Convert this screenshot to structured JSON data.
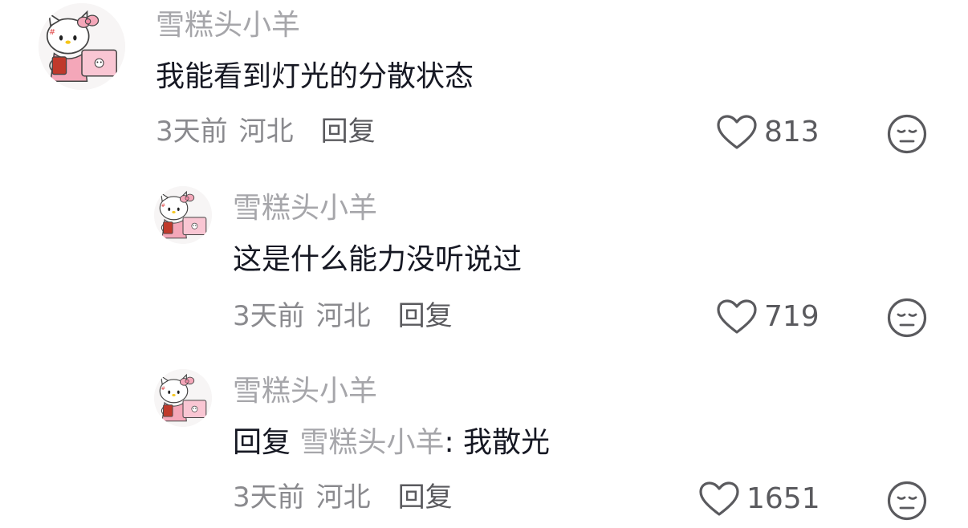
{
  "comments": [
    {
      "avatar_icon": "hello-kitty-avatar",
      "username": "雪糕头小羊",
      "content": "我能看到灯光的分散状态",
      "time": "3天前",
      "location": "河北",
      "reply_label": "回复",
      "likes": "813"
    },
    {
      "avatar_icon": "hello-kitty-avatar",
      "username": "雪糕头小羊",
      "content": "这是什么能力没听说过",
      "time": "3天前",
      "location": "河北",
      "reply_label": "回复",
      "likes": "719"
    },
    {
      "avatar_icon": "hello-kitty-avatar",
      "username": "雪糕头小羊",
      "content_prefix": "回复",
      "mention": "雪糕头小羊",
      "content_suffix": ": 我散光",
      "time": "3天前",
      "location": "河北",
      "reply_label": "回复",
      "likes": "1651"
    }
  ],
  "icons": {
    "like": "heart-outline-icon",
    "dislike": "neutral-face-icon"
  },
  "colors": {
    "username": "#a6a6aa",
    "content": "#161823",
    "meta": "#8a8a8e",
    "avatar_pink": "#f4a7b9"
  }
}
